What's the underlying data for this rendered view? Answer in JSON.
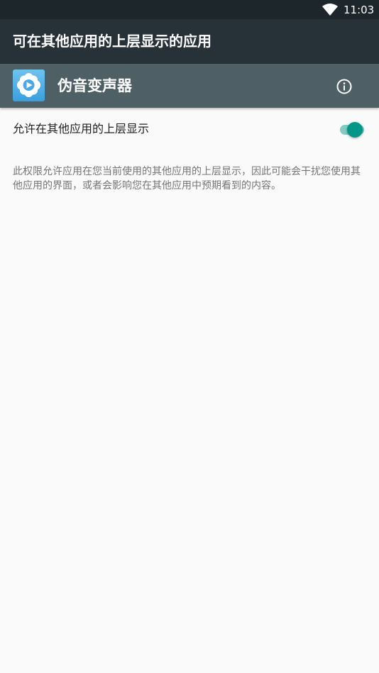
{
  "status_bar": {
    "time": "11:03",
    "wifi_icon": "wifi-icon"
  },
  "toolbar": {
    "title": "可在其他应用的上层显示的应用"
  },
  "app": {
    "name": "伪音变声器",
    "icon": "app-cloud-play-icon",
    "info_icon": "info-icon"
  },
  "setting": {
    "label": "允许在其他应用的上层显示",
    "enabled": true
  },
  "description": "此权限允许应用在您当前使用的其他应用的上层显示，因此可能会干扰您使用其他应用的界面，或者会影响您在其他应用中预期看到的内容。",
  "colors": {
    "status_bar": "#1d262b",
    "toolbar": "#263238",
    "app_header": "#4f5f66",
    "switch_thumb": "#009688",
    "switch_track": "#80cbc4",
    "background": "#fafafa"
  }
}
